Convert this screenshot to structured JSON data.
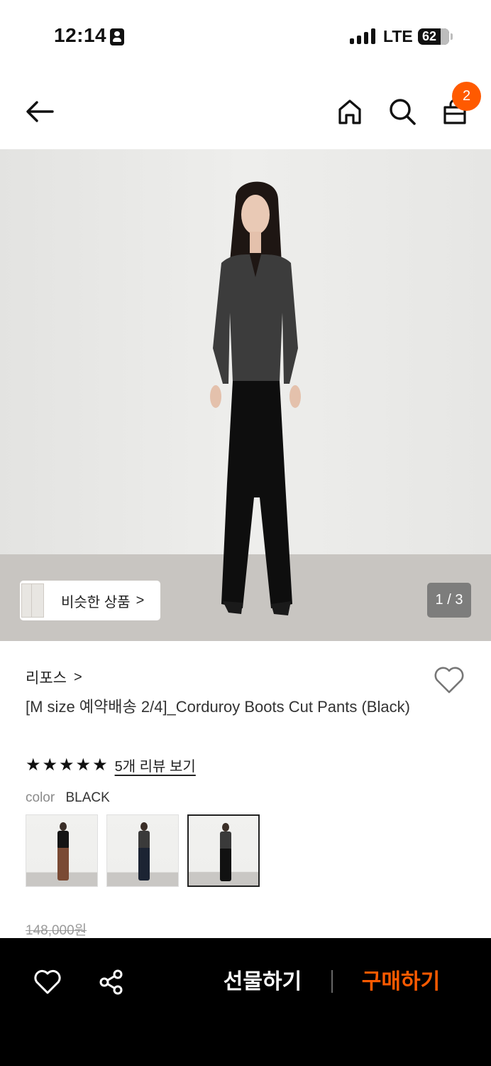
{
  "status_bar": {
    "time": "12:14",
    "network": "LTE",
    "battery": "62"
  },
  "header": {
    "cart_count": "2",
    "icons": [
      "back-arrow-icon",
      "home-icon",
      "search-icon",
      "shopping-bag-icon"
    ]
  },
  "gallery": {
    "similar_label": "비슷한 상품",
    "similar_chevron": ">",
    "page_indicator": "1 / 3"
  },
  "product": {
    "brand": "리포스",
    "brand_chevron": ">",
    "title": "[M size 예약배송 2/4]_Corduroy Boots Cut Pants (Black)",
    "rating_stars": 5,
    "review_link": "5개 리뷰 보기",
    "color_label": "color",
    "color_value": "BLACK",
    "swatches": [
      {
        "name": "brown",
        "top": "#141414",
        "legs": "#7a4a34"
      },
      {
        "name": "navy",
        "top": "#3a3a3a",
        "legs": "#1c2433"
      },
      {
        "name": "black",
        "top": "#3a3a3a",
        "legs": "#111111",
        "selected": true
      }
    ],
    "original_price": "148,000원"
  },
  "bottom_bar": {
    "gift_label": "선물하기",
    "buy_label": "구매하기"
  },
  "colors": {
    "accent": "#ff5a00",
    "bottom_bar_bg": "#000000"
  }
}
